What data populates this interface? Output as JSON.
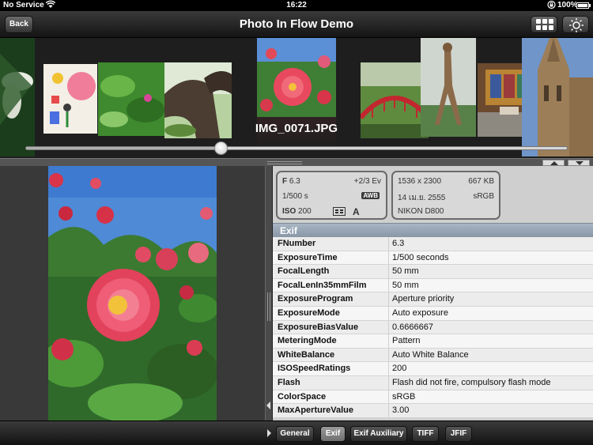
{
  "status_bar": {
    "carrier": "No Service",
    "time": "16:22",
    "battery": "100%"
  },
  "nav": {
    "back_label": "Back",
    "title": "Photo In Flow Demo"
  },
  "flow": {
    "caption": "IMG_0071.JPG",
    "slider_position": 0.36
  },
  "summary_card_left": {
    "f_label": "F",
    "f_value": "6.3",
    "ev": "+2/3 Ev",
    "shutter": "1/500 s",
    "wb_badge": "AWB",
    "iso_label": "ISO",
    "iso_value": "200",
    "mode": "A"
  },
  "summary_card_right": {
    "dimensions": "1536 x 2300",
    "filesize": "667 KB",
    "date": "14 เม.ย. 2555",
    "colorspace": "sRGB",
    "camera": "NIKON D800"
  },
  "exif": {
    "section_title": "Exif",
    "rows": [
      {
        "key": "FNumber",
        "value": "6.3"
      },
      {
        "key": "ExposureTime",
        "value": "1/500 seconds"
      },
      {
        "key": "FocalLength",
        "value": "50 mm"
      },
      {
        "key": "FocalLenIn35mmFilm",
        "value": "50 mm"
      },
      {
        "key": "ExposureProgram",
        "value": "Aperture priority"
      },
      {
        "key": "ExposureMode",
        "value": "Auto exposure"
      },
      {
        "key": "ExposureBiasValue",
        "value": "0.6666667"
      },
      {
        "key": "MeteringMode",
        "value": "Pattern"
      },
      {
        "key": "WhiteBalance",
        "value": "Auto White Balance"
      },
      {
        "key": "ISOSpeedRatings",
        "value": "200"
      },
      {
        "key": "Flash",
        "value": "Flash did not fire, compulsory flash mode"
      },
      {
        "key": "ColorSpace",
        "value": "sRGB"
      },
      {
        "key": "MaxApertureValue",
        "value": "3.00"
      }
    ]
  },
  "tabs": [
    {
      "label": "General",
      "active": false
    },
    {
      "label": "Exif",
      "active": true
    },
    {
      "label": "Exif Auxiliary",
      "active": false
    },
    {
      "label": "TIFF",
      "active": false
    },
    {
      "label": "JFIF",
      "active": false
    }
  ],
  "colors": {
    "section_header": "#8e9cae",
    "active_tab": "#8a8a8a"
  }
}
